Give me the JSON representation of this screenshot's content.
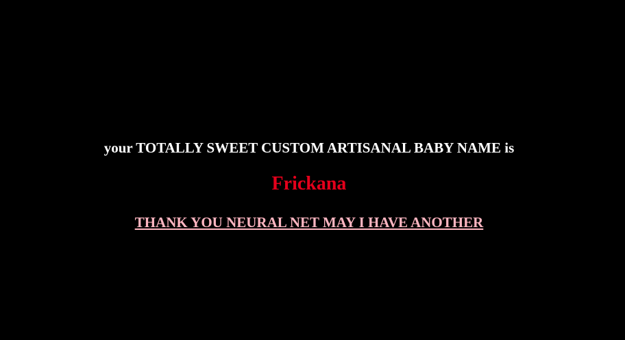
{
  "intro_text": "your TOTALLY SWEET CUSTOM ARTISANAL BABY NAME is",
  "baby_name": "Frickana",
  "another_link": {
    "label": "THANK YOU NEURAL NET MAY I HAVE ANOTHER"
  },
  "colors": {
    "background": "#000000",
    "intro": "#ffffff",
    "name": "#e4001b",
    "link": "#ffb6c1"
  }
}
